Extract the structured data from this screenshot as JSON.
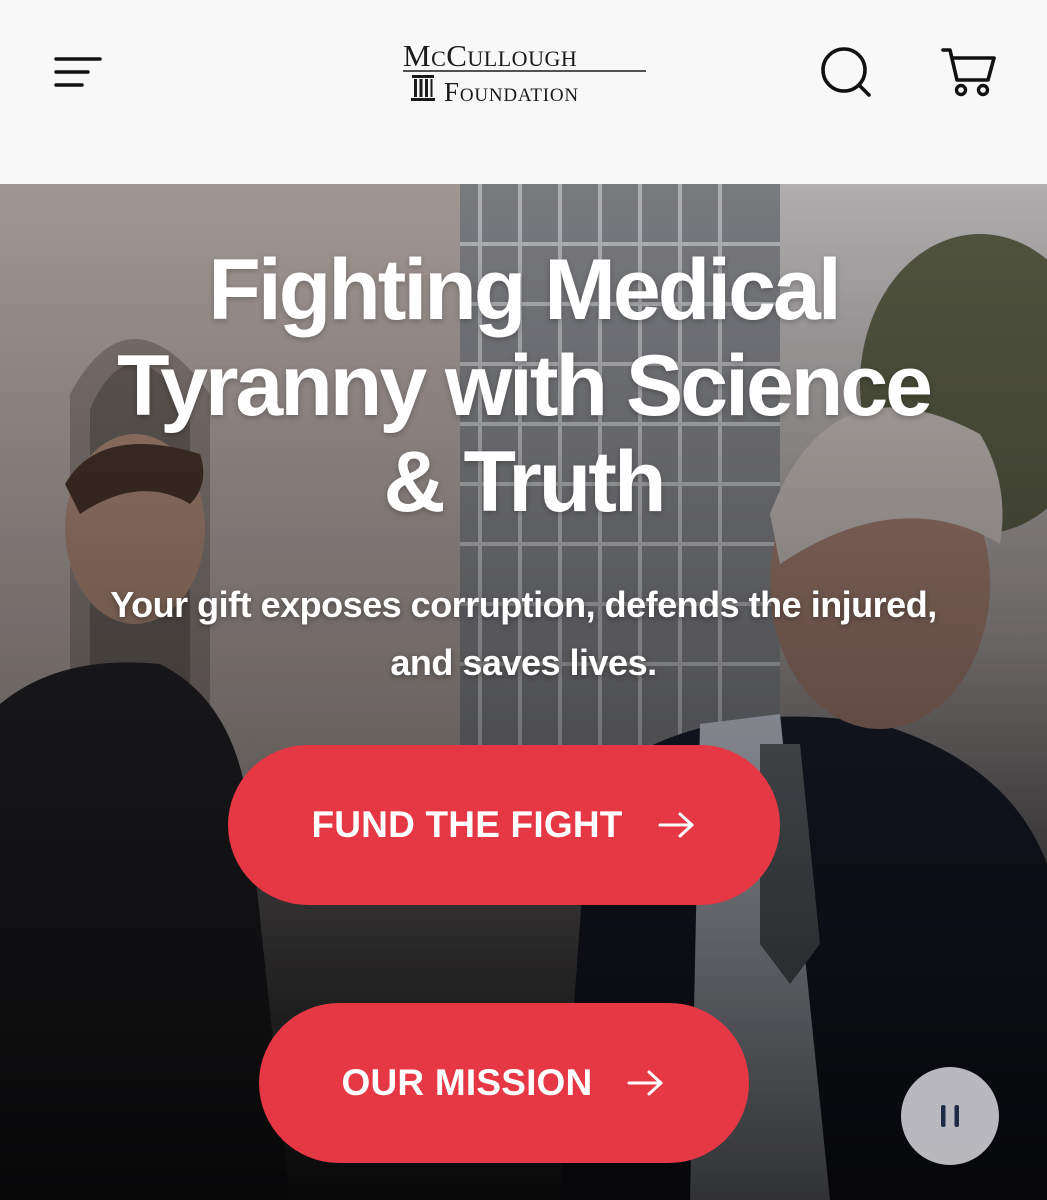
{
  "header": {
    "logo_line1": "McCullough",
    "logo_line2": "Foundation",
    "icons": {
      "menu": "menu-icon",
      "search": "search-icon",
      "cart": "cart-icon"
    }
  },
  "hero": {
    "title_line1": "Fighting Medical",
    "title_line2": "Tyranny with Science",
    "title_line3": "& Truth",
    "subtitle_line1": "Your gift exposes corruption, defends the injured,",
    "subtitle_line2": "and saves lives.",
    "primary_cta": "FUND THE FIGHT",
    "secondary_cta": "OUR MISSION",
    "pause_icon": "pause-icon"
  },
  "colors": {
    "accent": "#e53744",
    "header_bg": "#f8f8f9",
    "text_on_hero": "#ffffff",
    "pause_bg": "#c8c8cd",
    "pause_icon": "#1f2a44"
  }
}
